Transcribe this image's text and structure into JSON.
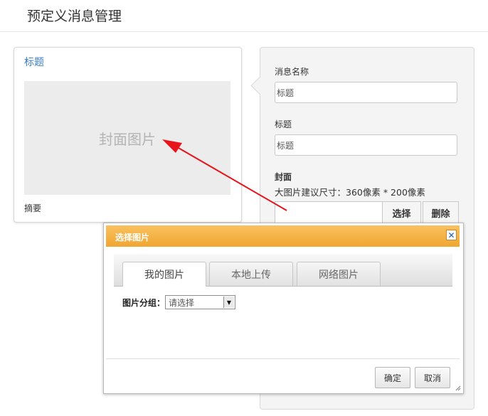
{
  "page": {
    "title": "预定义消息管理"
  },
  "preview": {
    "title": "标题",
    "cover_placeholder": "封面图片",
    "summary": "摘要"
  },
  "form": {
    "name_label": "消息名称",
    "name_value": "标题",
    "title_label": "标题",
    "title_value": "标题",
    "cover_label": "封面",
    "cover_hint": "大图片建议尺寸：360像素 * 200像素",
    "select_button": "选择",
    "delete_button": "删除"
  },
  "dialog": {
    "title": "选择图片",
    "close_icon": "close-icon",
    "tabs": [
      {
        "label": "我的图片",
        "active": true
      },
      {
        "label": "本地上传",
        "active": false
      },
      {
        "label": "网络图片",
        "active": false
      }
    ],
    "group_label": "图片分组：",
    "group_select": "请选择",
    "ok_button": "确定",
    "cancel_button": "取消"
  },
  "colors": {
    "link_blue": "#3a7cc4",
    "dialog_header": "#f0a631",
    "annotation_arrow": "#e8141b"
  }
}
